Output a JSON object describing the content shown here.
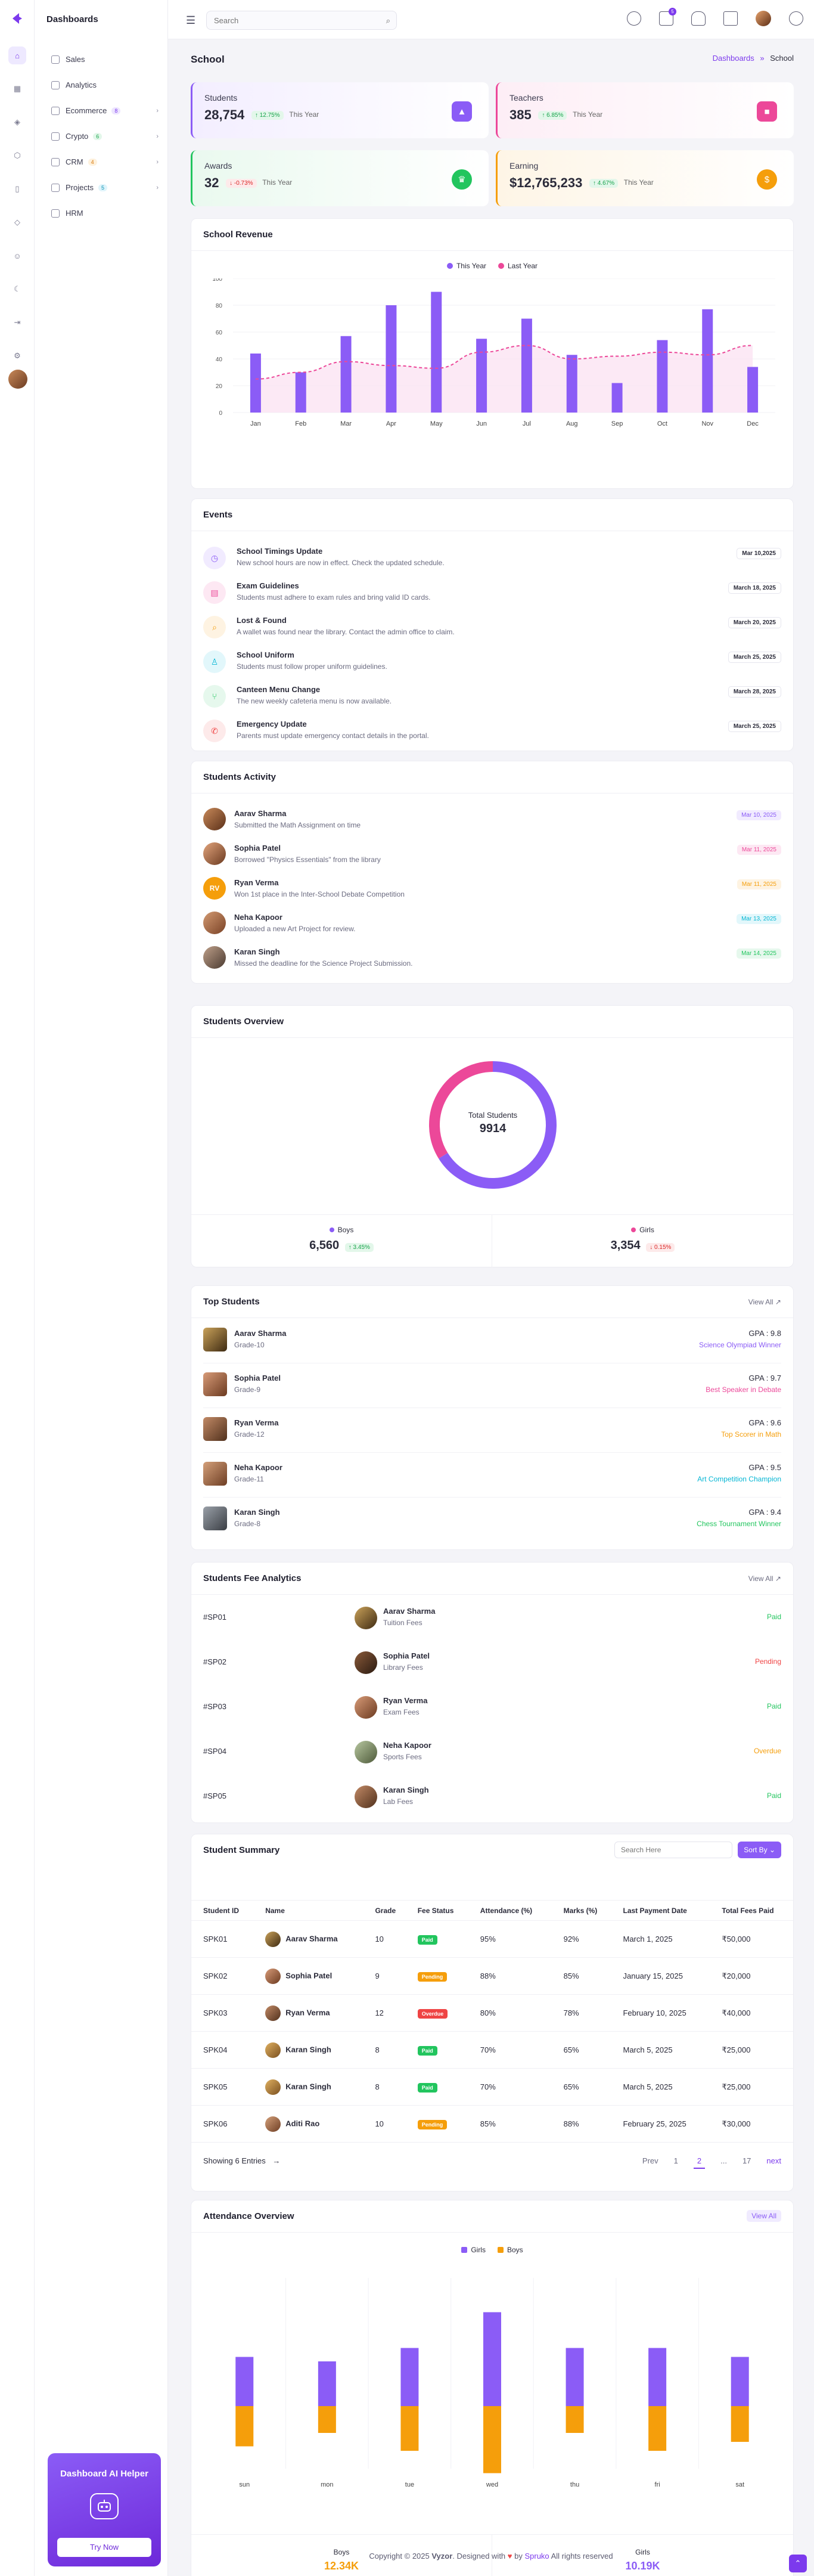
{
  "sidebar": {
    "brand": "Dashboards",
    "items": [
      {
        "label": "Sales"
      },
      {
        "label": "Analytics"
      },
      {
        "label": "Ecommerce",
        "badge": "8"
      },
      {
        "label": "Crypto",
        "badge": "6"
      },
      {
        "label": "CRM",
        "badge": "4"
      },
      {
        "label": "Projects",
        "badge": "5"
      },
      {
        "label": "HRM"
      }
    ],
    "ai_helper": {
      "title": "Dashboard AI Helper",
      "button": "Try Now"
    }
  },
  "header": {
    "search_placeholder": "Search",
    "cart_count": "5"
  },
  "page": {
    "title": "School",
    "crumb_parent": "Dashboards",
    "crumb_sep": "»",
    "crumb_current": "School"
  },
  "kpis": [
    {
      "label": "Students",
      "value": "28,754",
      "change": "↑ 12.75%",
      "period": "This Year",
      "color": "#7c3aed"
    },
    {
      "label": "Teachers",
      "value": "385",
      "change": "↑ 6.85%",
      "period": "This Year",
      "color": "#ec4899"
    },
    {
      "label": "Awards",
      "value": "32",
      "change": "↓ -0.73%",
      "period": "This Year",
      "color": "#22c55e"
    },
    {
      "label": "Earning",
      "value": "$12,765,233",
      "change": "↑ 4.67%",
      "period": "This Year",
      "color": "#f59e0b"
    }
  ],
  "revenue": {
    "title": "School Revenue",
    "chart_data": {
      "type": "bar",
      "categories": [
        "Jan",
        "Feb",
        "Mar",
        "Apr",
        "May",
        "Jun",
        "Jul",
        "Aug",
        "Sep",
        "Oct",
        "Nov",
        "Dec"
      ],
      "series": [
        {
          "name": "This Year",
          "values": [
            44,
            30,
            57,
            80,
            90,
            55,
            70,
            43,
            22,
            54,
            77,
            34
          ],
          "color": "#8b5cf6"
        },
        {
          "name": "Last Year",
          "values": [
            25,
            30,
            38,
            35,
            33,
            45,
            50,
            40,
            42,
            45,
            43,
            50
          ],
          "color": "#ec4899"
        }
      ],
      "ylim": [
        0,
        100
      ],
      "yticks": [
        0,
        20,
        40,
        60,
        80,
        100
      ]
    }
  },
  "events": {
    "title": "Events",
    "items": [
      {
        "title": "School Timings Update",
        "desc": "New school hours are now in effect. Check the updated schedule.",
        "date": "Mar 10,2025",
        "color": "#8b5cf6",
        "bg": "#f1ebff",
        "icon": "clock-icon",
        "glyph": "◷"
      },
      {
        "title": "Exam Guidelines",
        "desc": "Students must adhere to exam rules and bring valid ID cards.",
        "date": "March 18, 2025",
        "color": "#ec4899",
        "bg": "#fde8f3",
        "icon": "document-icon",
        "glyph": "▤"
      },
      {
        "title": "Lost & Found",
        "desc": "A wallet was found near the library. Contact the admin office to claim.",
        "date": "March 20, 2025",
        "color": "#f59e0b",
        "bg": "#fef3e2",
        "icon": "search-icon",
        "glyph": "⌕"
      },
      {
        "title": "School Uniform",
        "desc": "Students must follow proper uniform guidelines.",
        "date": "March 25, 2025",
        "color": "#06b6d4",
        "bg": "#e2f7fb",
        "icon": "shirt-icon",
        "glyph": "♙"
      },
      {
        "title": "Canteen Menu Change",
        "desc": "The new weekly cafeteria menu is now available.",
        "date": "March 28, 2025",
        "color": "#22c55e",
        "bg": "#e6f8ed",
        "icon": "utensils-icon",
        "glyph": "⑂"
      },
      {
        "title": "Emergency Update",
        "desc": "Parents must update emergency contact details in the portal.",
        "date": "March 25, 2025",
        "color": "#ef4444",
        "bg": "#fdeaea",
        "icon": "phone-icon",
        "glyph": "✆"
      }
    ]
  },
  "activity": {
    "title": "Students Activity",
    "items": [
      {
        "name": "Aarav Sharma",
        "desc": "Submitted the Math Assignment on time",
        "date": "Mar 10, 2025",
        "color": "#8b5cf6",
        "bg": "#f1ebff"
      },
      {
        "name": "Sophia Patel",
        "desc": "Borrowed \"Physics Essentials\" from the library",
        "date": "Mar 11, 2025",
        "color": "#ec4899",
        "bg": "#fde8f3"
      },
      {
        "name": "Ryan Verma",
        "desc": "Won 1st place in the Inter-School Debate Competition",
        "date": "Mar 11, 2025",
        "color": "#f59e0b",
        "bg": "#fef3e2",
        "initials": "RV"
      },
      {
        "name": "Neha Kapoor",
        "desc": "Uploaded a new Art Project for review.",
        "date": "Mar 13, 2025",
        "color": "#06b6d4",
        "bg": "#e2f7fb"
      },
      {
        "name": "Karan Singh",
        "desc": "Missed the deadline for the Science Project Submission.",
        "date": "Mar 14, 2025",
        "color": "#22c55e",
        "bg": "#e6f8ed"
      }
    ]
  },
  "overview": {
    "title": "Students Overview",
    "center_label": "Total Students",
    "center_value": "9914",
    "boys": {
      "label": "Boys",
      "value": "6,560",
      "change": "↑ 3.45%"
    },
    "girls": {
      "label": "Girls",
      "value": "3,354",
      "change": "↓ 0.15%"
    },
    "chart_data": {
      "type": "pie",
      "labels": [
        "Boys",
        "Girls"
      ],
      "values": [
        6560,
        3354
      ],
      "colors": [
        "#8b5cf6",
        "#ec4899"
      ]
    }
  },
  "top_students": {
    "title": "Top Students",
    "view_all": "View All ↗",
    "items": [
      {
        "name": "Aarav Sharma",
        "grade": "Grade-10",
        "gpa": "GPA : 9.8",
        "award": "Science Olympiad Winner",
        "color": "#8b5cf6"
      },
      {
        "name": "Sophia Patel",
        "grade": "Grade-9",
        "gpa": "GPA : 9.7",
        "award": "Best Speaker in Debate",
        "color": "#ec4899"
      },
      {
        "name": "Ryan Verma",
        "grade": "Grade-12",
        "gpa": "GPA : 9.6",
        "award": "Top Scorer in Math",
        "color": "#f59e0b"
      },
      {
        "name": "Neha Kapoor",
        "grade": "Grade-11",
        "gpa": "GPA : 9.5",
        "award": "Art Competition Champion",
        "color": "#06b6d4"
      },
      {
        "name": "Karan Singh",
        "grade": "Grade-8",
        "gpa": "GPA : 9.4",
        "award": "Chess Tournament Winner",
        "color": "#22c55e"
      }
    ]
  },
  "fees": {
    "title": "Students Fee Analytics",
    "view_all": "View All ↗",
    "items": [
      {
        "id": "#SP01",
        "name": "Aarav Sharma",
        "type": "Tuition Fees",
        "status": "Paid",
        "color": "#22c55e"
      },
      {
        "id": "#SP02",
        "name": "Sophia Patel",
        "type": "Library Fees",
        "status": "Pending",
        "color": "#ef4444"
      },
      {
        "id": "#SP03",
        "name": "Ryan Verma",
        "type": "Exam Fees",
        "status": "Paid",
        "color": "#22c55e"
      },
      {
        "id": "#SP04",
        "name": "Neha Kapoor",
        "type": "Sports Fees",
        "status": "Overdue",
        "color": "#f59e0b"
      },
      {
        "id": "#SP05",
        "name": "Karan Singh",
        "type": "Lab Fees",
        "status": "Paid",
        "color": "#22c55e"
      }
    ]
  },
  "summary": {
    "title": "Student Summary",
    "search_placeholder": "Search Here",
    "sort_label": "Sort By ⌄",
    "columns": [
      "Student ID",
      "Name",
      "Grade",
      "Fee Status",
      "Attendance (%)",
      "Marks (%)",
      "Last Payment Date",
      "Total Fees Paid"
    ],
    "rows": [
      {
        "id": "SPK01",
        "name": "Aarav Sharma",
        "grade": "10",
        "status": "Paid",
        "scolor": "#22c55e",
        "att": "95%",
        "marks": "92%",
        "date": "March 1, 2025",
        "fees": "₹50,000"
      },
      {
        "id": "SPK02",
        "name": "Sophia Patel",
        "grade": "9",
        "status": "Pending",
        "scolor": "#f59e0b",
        "att": "88%",
        "marks": "85%",
        "date": "January 15, 2025",
        "fees": "₹20,000"
      },
      {
        "id": "SPK03",
        "name": "Ryan Verma",
        "grade": "12",
        "status": "Overdue",
        "scolor": "#ef4444",
        "att": "80%",
        "marks": "78%",
        "date": "February 10, 2025",
        "fees": "₹40,000"
      },
      {
        "id": "SPK04",
        "name": "Karan Singh",
        "grade": "8",
        "status": "Paid",
        "scolor": "#22c55e",
        "att": "70%",
        "marks": "65%",
        "date": "March 5, 2025",
        "fees": "₹25,000"
      },
      {
        "id": "SPK05",
        "name": "Karan Singh",
        "grade": "8",
        "status": "Paid",
        "scolor": "#22c55e",
        "att": "70%",
        "marks": "65%",
        "date": "March 5, 2025",
        "fees": "₹25,000"
      },
      {
        "id": "SPK06",
        "name": "Aditi Rao",
        "grade": "10",
        "status": "Pending",
        "scolor": "#f59e0b",
        "att": "85%",
        "marks": "88%",
        "date": "February 25, 2025",
        "fees": "₹30,000"
      }
    ],
    "showing": "Showing 6 Entries",
    "pages": [
      "Prev",
      "1",
      "2",
      "...",
      "17",
      "next"
    ]
  },
  "attendance": {
    "title": "Attendance Overview",
    "view_all": "View All",
    "boys": {
      "label": "Boys",
      "value": "12.34K"
    },
    "girls": {
      "label": "Girls",
      "value": "10.19K"
    },
    "chart_data": {
      "type": "bar",
      "stacked": true,
      "categories": [
        "sun",
        "mon",
        "tue",
        "wed",
        "thu",
        "fri",
        "sat"
      ],
      "series": [
        {
          "name": "Girls",
          "values": [
            55,
            50,
            65,
            105,
            65,
            65,
            55
          ],
          "color": "#8b5cf6"
        },
        {
          "name": "Boys",
          "values": [
            45,
            30,
            50,
            75,
            30,
            50,
            40
          ],
          "color": "#f59e0b"
        }
      ],
      "ylim": [
        0,
        200
      ]
    }
  },
  "footer": {
    "pre": "Copyright © 2025 ",
    "brand": "Vyzor",
    "mid": ". Designed with ",
    "heart": "♥",
    "by": " by ",
    "author": "Spruko",
    "post": " All rights reserved"
  }
}
